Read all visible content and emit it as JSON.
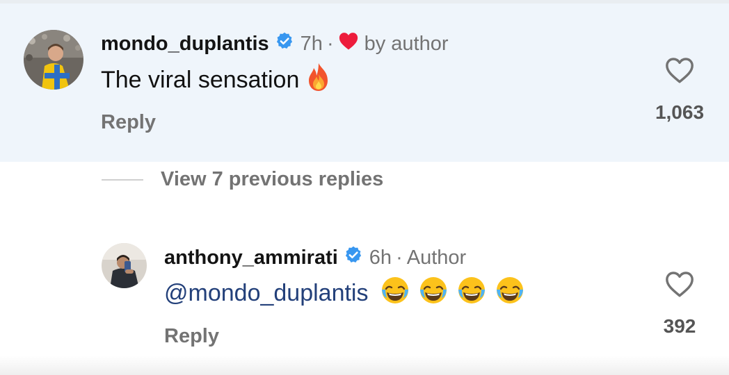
{
  "comments": [
    {
      "username": "mondo_duplantis",
      "time": "7h",
      "separator": "·",
      "liked_by_label": "by author",
      "text": "The viral sensation",
      "text_emoji": "fire-emoji",
      "reply_label": "Reply",
      "like_count": "1,063",
      "highlighted": true
    },
    {
      "username": "anthony_ammirati",
      "time": "6h",
      "separator": "·",
      "badge": "Author",
      "mention": "@mondo_duplantis",
      "text_emoji": "face-with-tears-of-joy-emoji",
      "emoji_count": 4,
      "reply_label": "Reply",
      "like_count": "392"
    }
  ],
  "thread": {
    "view_replies_label": "View 7 previous replies"
  },
  "colors": {
    "highlight_bg": "#eff5fb",
    "verified_blue": "#3897f0",
    "heart_red": "#ed1c3c",
    "meta_gray": "#737373",
    "mention_blue": "#23407a"
  }
}
